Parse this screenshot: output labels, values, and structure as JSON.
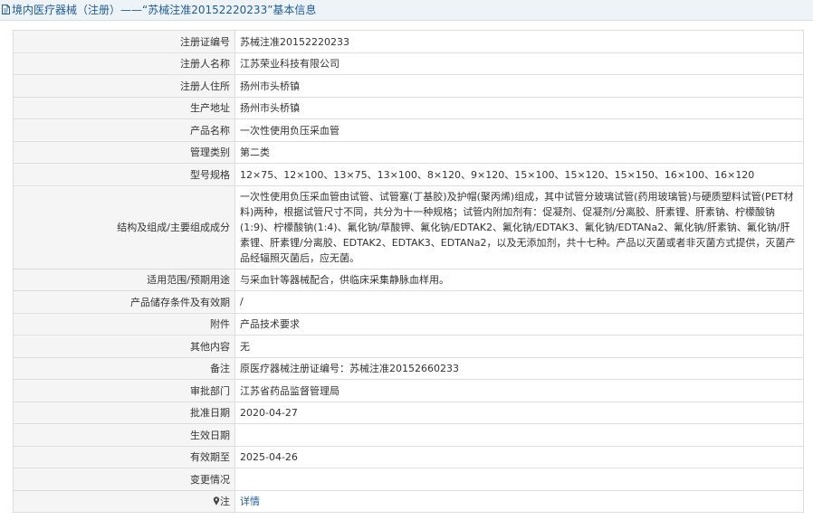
{
  "header": {
    "title": "境内医疗器械（注册）——“苏械注准20152220233”基本信息",
    "icon": "document-icon",
    "color": "#1d5c95"
  },
  "rows": [
    {
      "name": "registration-number",
      "label": "注册证编号",
      "value": "苏械注准20152220233"
    },
    {
      "name": "registrant-name",
      "label": "注册人名称",
      "value": "江苏荣业科技有限公司"
    },
    {
      "name": "registrant-address",
      "label": "注册人住所",
      "value": "扬州市头桥镇"
    },
    {
      "name": "production-address",
      "label": "生产地址",
      "value": "扬州市头桥镇"
    },
    {
      "name": "product-name",
      "label": "产品名称",
      "value": "一次性使用负压采血管"
    },
    {
      "name": "management-class",
      "label": "管理类别",
      "value": "第二类"
    },
    {
      "name": "model-spec",
      "label": "型号规格",
      "value": "12×75、12×100、13×75、13×100、8×120、9×120、15×100、15×120、15×150、16×100、16×120"
    },
    {
      "name": "structure-composition",
      "label": "结构及组成/主要组成成分",
      "value": "一次性使用负压采血管由试管、试管塞(丁基胶)及护帽(聚丙烯)组成，其中试管分玻璃试管(药用玻璃管)与硬质塑料试管(PET材料)两种，根据试管尺寸不同，共分为十一种规格；试管内附加剂有：促凝剂、促凝剂/分离胶、肝素锂、肝素钠、柠檬酸钠(1:9)、柠檬酸钠(1:4)、氟化钠/草酸钾、氟化钠/EDTAK2、氟化钠/EDTAK3、氟化钠/EDTANa2、氟化钠/肝素钠、氟化钠/肝素锂、肝素锂/分离胶、EDTAK2、EDTAK3、EDTANa2，以及无添加剂，共十七种。产品以灭菌或者非灭菌方式提供，灭菌产品经辐照灭菌后，应无菌。",
      "tall": true
    },
    {
      "name": "intended-use",
      "label": "适用范围/预期用途",
      "value": "与采血针等器械配合，供临床采集静脉血样用。"
    },
    {
      "name": "storage-conditions",
      "label": "产品储存条件及有效期",
      "value": "/"
    },
    {
      "name": "attachment",
      "label": "附件",
      "value": "产品技术要求"
    },
    {
      "name": "other-content",
      "label": "其他内容",
      "value": "无"
    },
    {
      "name": "remarks",
      "label": "备注",
      "value": "原医疗器械注册证编号：苏械注准20152660233"
    },
    {
      "name": "approval-department",
      "label": "审批部门",
      "value": "江苏省药品监督管理局"
    },
    {
      "name": "approval-date",
      "label": "批准日期",
      "value": "2020-04-27"
    },
    {
      "name": "effective-date",
      "label": "生效日期",
      "value": ""
    },
    {
      "name": "expiry-date",
      "label": "有效期至",
      "value": "2025-04-26"
    },
    {
      "name": "change-status",
      "label": "变更情况",
      "value": ""
    }
  ],
  "note": {
    "label": "注",
    "icon": "pin-icon",
    "link_text": "详情"
  }
}
